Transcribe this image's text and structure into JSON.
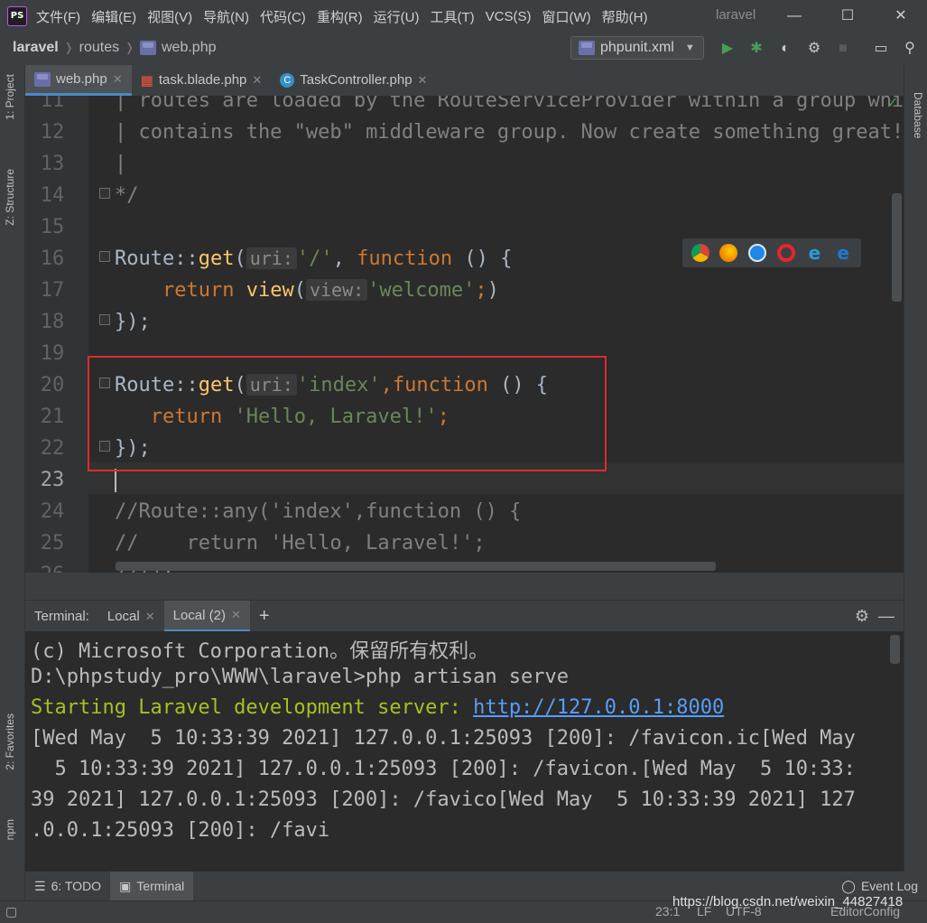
{
  "app": {
    "logo": "PS",
    "project_title": "laravel",
    "menu": [
      "文件(F)",
      "编辑(E)",
      "视图(V)",
      "导航(N)",
      "代码(C)",
      "重构(R)",
      "运行(U)",
      "工具(T)",
      "VCS(S)",
      "窗口(W)",
      "帮助(H)"
    ]
  },
  "window_controls": {
    "minimize": "—",
    "maximize": "☐",
    "close": "✕"
  },
  "breadcrumb": [
    "laravel",
    "routes",
    "web.php"
  ],
  "run_config": {
    "label": "phpunit.xml",
    "icon": "php-icon"
  },
  "toolbar_icons": [
    "run-icon",
    "debug-icon",
    "coverage-icon",
    "profile-icon",
    "stop-icon",
    "project-structure-icon",
    "search-icon"
  ],
  "left_strip": {
    "project": "1: Project",
    "structure": "Z: Structure",
    "favorites": "2: Favorites",
    "npm": "npm"
  },
  "right_strip": {
    "database": "Database"
  },
  "tabs": [
    {
      "label": "web.php",
      "active": true
    },
    {
      "label": "task.blade.php",
      "active": false
    },
    {
      "label": "TaskController.php",
      "active": false
    }
  ],
  "editor": {
    "lines": [
      {
        "n": "11",
        "text": "| routes are loaded by the RouteServiceProvider within a group which"
      },
      {
        "n": "12",
        "text": "| contains the \"web\" middleware group. Now create something great!"
      },
      {
        "n": "13",
        "text": "|"
      },
      {
        "n": "14",
        "text": "*/"
      },
      {
        "n": "15",
        "text": ""
      },
      {
        "n": "16"
      },
      {
        "n": "17"
      },
      {
        "n": "18",
        "text": "});"
      },
      {
        "n": "19",
        "text": ""
      },
      {
        "n": "20"
      },
      {
        "n": "21"
      },
      {
        "n": "22",
        "text": "});"
      },
      {
        "n": "23",
        "text": ""
      },
      {
        "n": "24",
        "text": "//Route::any('index',function () {"
      },
      {
        "n": "25",
        "text": "//    return 'Hello, Laravel!';"
      },
      {
        "n": "26",
        "text": "//});"
      }
    ],
    "route_fn": "Route::",
    "get_fn": "get",
    "uri_hint": "uri:",
    "view_hint": "view:",
    "l16_str": "'/'",
    "function_kw": "function",
    "l16_tail": " () {",
    "return_kw": "return",
    "view_fn": "view",
    "l17_str": "'welcome'",
    "l20_str": "'index'",
    "l21_str": "'Hello, Laravel!'",
    "browser_icons": [
      "chrome-icon",
      "firefox-icon",
      "safari-icon",
      "opera-icon",
      "ie-icon",
      "edge-icon"
    ]
  },
  "terminal": {
    "title": "Terminal:",
    "tabs": [
      {
        "label": "Local",
        "active": false
      },
      {
        "label": "Local (2)",
        "active": true
      }
    ],
    "add": "+",
    "lines": [
      "(c) Microsoft Corporation。保留所有权利。",
      "D:\\phpstudy_pro\\WWW\\laravel>php artisan serve",
      "",
      "[Wed May  5 10:33:39 2021] 127.0.0.1:25093 [200]: /favicon.ic[Wed May",
      "  5 10:33:39 2021] 127.0.0.1:25093 [200]: /favicon.[Wed May  5 10:33:",
      "39 2021] 127.0.0.1:25093 [200]: /favico[Wed May  5 10:33:39 2021] 127",
      ".0.0.1:25093 [200]: /favi"
    ],
    "server_msg": "Starting Laravel development server: ",
    "server_url": "http://127.0.0.1:8000"
  },
  "bottom_tabs": [
    {
      "label": "6: TODO",
      "active": false
    },
    {
      "label": "Terminal",
      "active": true
    }
  ],
  "event_log": "Event Log",
  "status": {
    "position": "23:1",
    "line_sep": "LF",
    "encoding": "UTF-8",
    "editorconfig": "EditorConfig"
  },
  "watermark": "https://blog.csdn.net/weixin_44827418"
}
